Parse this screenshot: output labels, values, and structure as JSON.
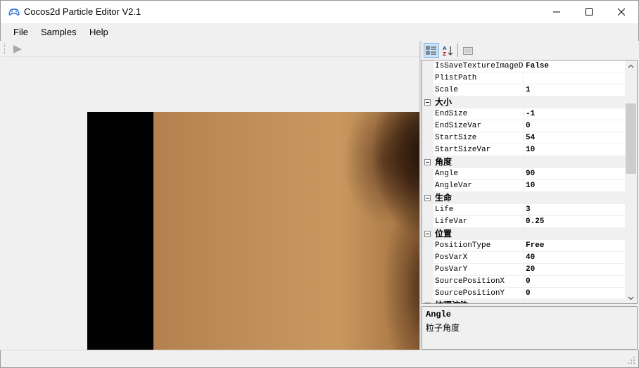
{
  "window": {
    "title": "Cocos2d Particle Editor V2.1",
    "minimize_glyph": "─",
    "maximize_glyph": "□",
    "close_glyph": "✕"
  },
  "menu": {
    "items": [
      {
        "label": "File"
      },
      {
        "label": "Samples"
      },
      {
        "label": "Help"
      }
    ]
  },
  "toolbar": {
    "play_icon": "play-icon"
  },
  "property_grid": {
    "toolbar_icons": [
      "categorized-icon",
      "alphabetical-icon",
      "property-pages-icon"
    ],
    "rows": [
      {
        "kind": "prop",
        "name": "IsSaveTextureImageData",
        "value": "False"
      },
      {
        "kind": "prop",
        "name": "PlistPath",
        "value": ""
      },
      {
        "kind": "prop",
        "name": "Scale",
        "value": "1"
      },
      {
        "kind": "cat",
        "name": "大小"
      },
      {
        "kind": "prop",
        "name": "EndSize",
        "value": "-1"
      },
      {
        "kind": "prop",
        "name": "EndSizeVar",
        "value": "0"
      },
      {
        "kind": "prop",
        "name": "StartSize",
        "value": "54"
      },
      {
        "kind": "prop",
        "name": "StartSizeVar",
        "value": "10"
      },
      {
        "kind": "cat",
        "name": "角度"
      },
      {
        "kind": "prop",
        "name": "Angle",
        "value": "90"
      },
      {
        "kind": "prop",
        "name": "AngleVar",
        "value": "10"
      },
      {
        "kind": "cat",
        "name": "生命"
      },
      {
        "kind": "prop",
        "name": "Life",
        "value": "3"
      },
      {
        "kind": "prop",
        "name": "LifeVar",
        "value": "0.25"
      },
      {
        "kind": "cat",
        "name": "位置"
      },
      {
        "kind": "prop",
        "name": "PositionType",
        "value": "Free"
      },
      {
        "kind": "prop",
        "name": "PosVarX",
        "value": "40"
      },
      {
        "kind": "prop",
        "name": "PosVarY",
        "value": "20"
      },
      {
        "kind": "prop",
        "name": "SourcePositionX",
        "value": "0"
      },
      {
        "kind": "prop",
        "name": "SourcePositionY",
        "value": "0"
      },
      {
        "kind": "cat",
        "name": "纹理渲染"
      }
    ],
    "description": {
      "title": "Angle",
      "text": "粒子角度"
    }
  },
  "colors": {
    "selection_blue": "#cce4f7",
    "window_bg": "#f0f0f0",
    "grid_bg": "#ffffff"
  }
}
